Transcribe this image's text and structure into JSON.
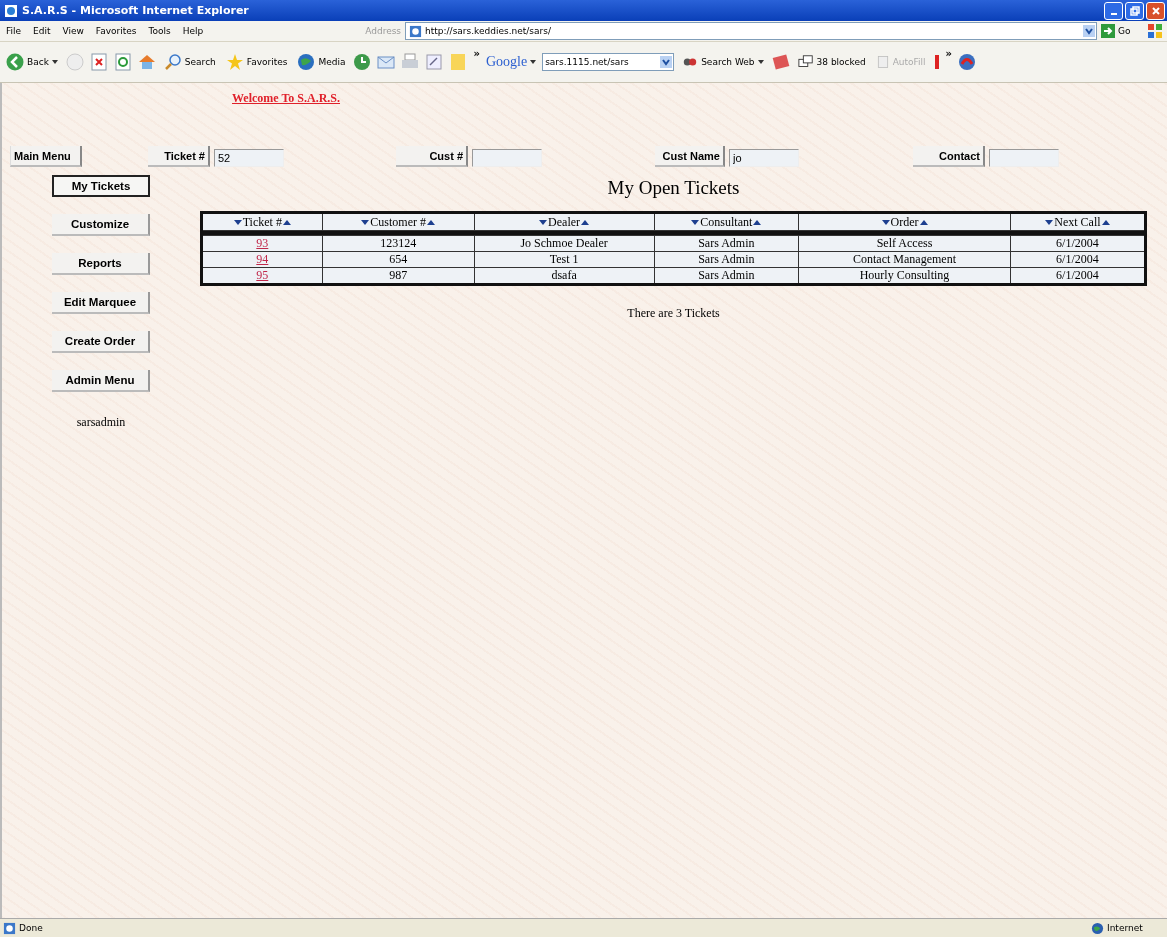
{
  "window": {
    "title": "S.A.R.S - Microsoft Internet Explorer"
  },
  "menu_bar": [
    "File",
    "Edit",
    "View",
    "Favorites",
    "Tools",
    "Help"
  ],
  "address": {
    "label": "Address",
    "url": "http://sars.keddies.net/sars/",
    "go": "Go"
  },
  "toolbar": {
    "back": "Back",
    "search": "Search",
    "favorites": "Favorites",
    "media": "Media",
    "more": "»"
  },
  "google": {
    "label": "Google",
    "query": "sars.1115.net/sars",
    "search_web": "Search Web",
    "blocked": "38 blocked",
    "autofill": "AutoFill",
    "more": "»"
  },
  "page": {
    "welcome": "Welcome To S.A.R.S.",
    "search_row": [
      {
        "button": "Main Menu"
      },
      {
        "button": "Ticket #",
        "value": "52"
      },
      {
        "button": "Cust #"
      },
      {
        "button": "Cust Name",
        "value": "jo"
      },
      {
        "button": "Contact"
      }
    ],
    "sidebar": [
      {
        "label": "My Tickets",
        "selected": true
      },
      {
        "label": "Customize",
        "selected": false
      },
      {
        "label": "Reports",
        "selected": false
      },
      {
        "label": "Edit Marquee",
        "selected": false
      },
      {
        "label": "Create Order",
        "selected": false
      },
      {
        "label": "Admin Menu",
        "selected": false
      }
    ],
    "user": "sarsadmin",
    "heading": "My Open Tickets",
    "table": {
      "columns": [
        "Ticket #",
        "Customer #",
        "Dealer",
        "Consultant",
        "Order",
        "Next Call"
      ],
      "rows": [
        [
          "93",
          "123124",
          "Jo Schmoe Dealer",
          "Sars Admin",
          "Self Access",
          "6/1/2004"
        ],
        [
          "94",
          "654",
          "Test 1",
          "Sars Admin",
          "Contact Management",
          "6/1/2004"
        ],
        [
          "95",
          "987",
          "dsafa",
          "Sars Admin",
          "Hourly Consulting",
          "6/1/2004"
        ]
      ]
    },
    "footer": "There are 3 Tickets"
  },
  "status_bar": {
    "text": "Done",
    "zone": "Internet"
  }
}
